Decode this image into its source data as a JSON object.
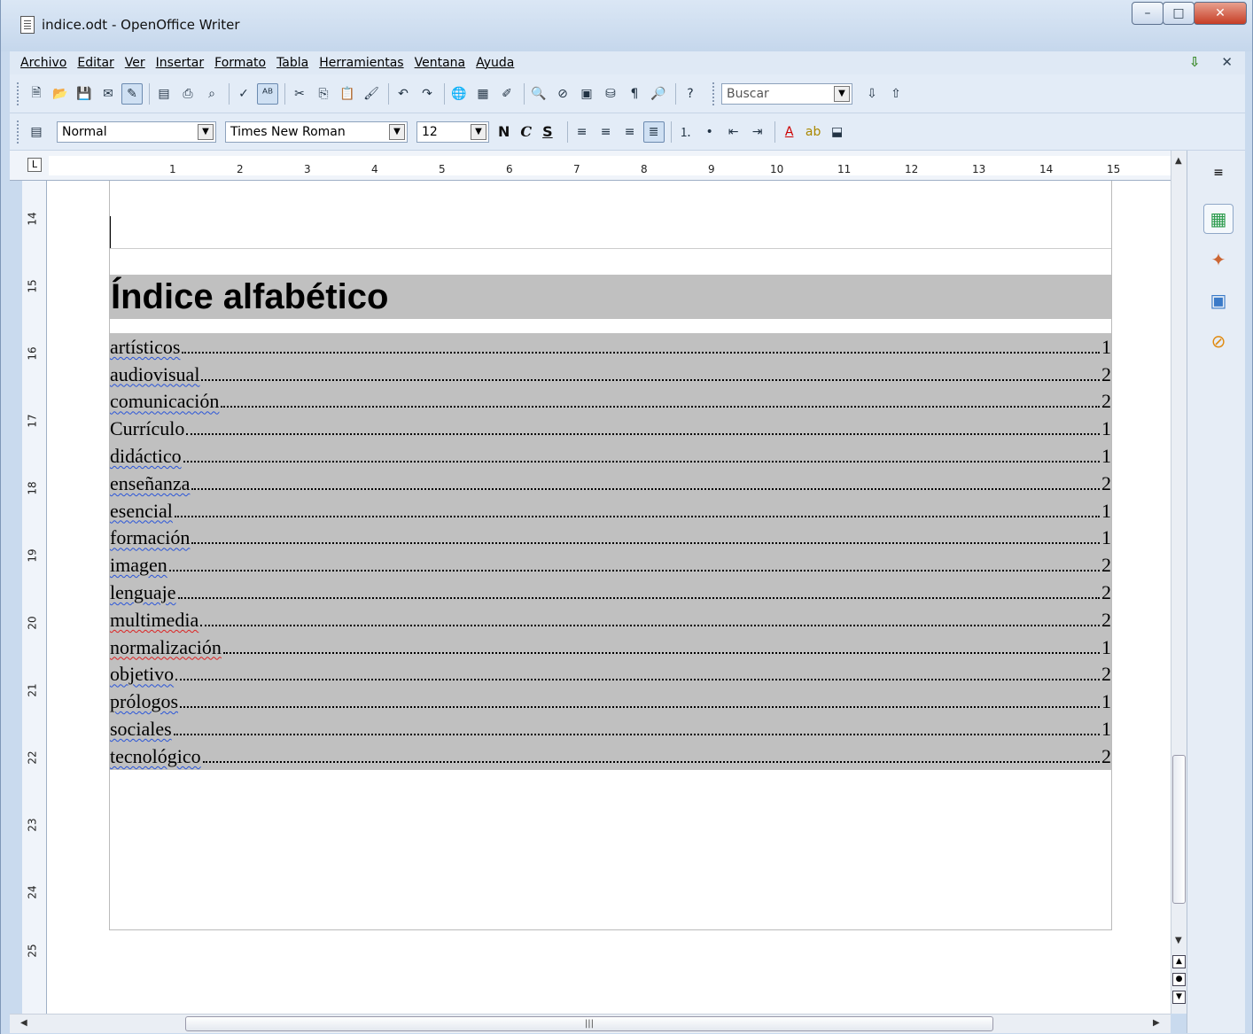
{
  "window": {
    "title": "indice.odt - OpenOffice Writer"
  },
  "menu": {
    "items": [
      "Archivo",
      "Editar",
      "Ver",
      "Insertar",
      "Formato",
      "Tabla",
      "Herramientas",
      "Ventana",
      "Ayuda"
    ]
  },
  "search": {
    "value": "Buscar"
  },
  "formatting": {
    "style": "Normal",
    "font": "Times New Roman",
    "size": "12",
    "bold": "N",
    "italic": "C",
    "underline": "S"
  },
  "ruler": {
    "numbers": [
      "1",
      "2",
      "3",
      "4",
      "5",
      "6",
      "7",
      "8",
      "9",
      "10",
      "11",
      "12",
      "13",
      "14",
      "15"
    ],
    "vnumbers": [
      "14",
      "15",
      "16",
      "17",
      "18",
      "19",
      "20",
      "21",
      "22",
      "23",
      "24",
      "25"
    ]
  },
  "document": {
    "index_title": "Índice alfabético",
    "entries": [
      {
        "term": "artísticos",
        "page": "1"
      },
      {
        "term": "audiovisual",
        "page": "2"
      },
      {
        "term": "comunicación",
        "page": "2"
      },
      {
        "term": "Currículo",
        "page": "1"
      },
      {
        "term": "didáctico",
        "page": "1"
      },
      {
        "term": "enseñanza",
        "page": "2"
      },
      {
        "term": "esencial",
        "page": "1"
      },
      {
        "term": "formación",
        "page": "1"
      },
      {
        "term": "imagen",
        "page": "2"
      },
      {
        "term": "lenguaje",
        "page": "2"
      },
      {
        "term": "multimedia",
        "page": "2"
      },
      {
        "term": "normalización",
        "page": "1"
      },
      {
        "term": "objetivo",
        "page": "2"
      },
      {
        "term": "prólogos",
        "page": "1"
      },
      {
        "term": "sociales",
        "page": "1"
      },
      {
        "term": "tecnológico",
        "page": "2"
      }
    ]
  }
}
